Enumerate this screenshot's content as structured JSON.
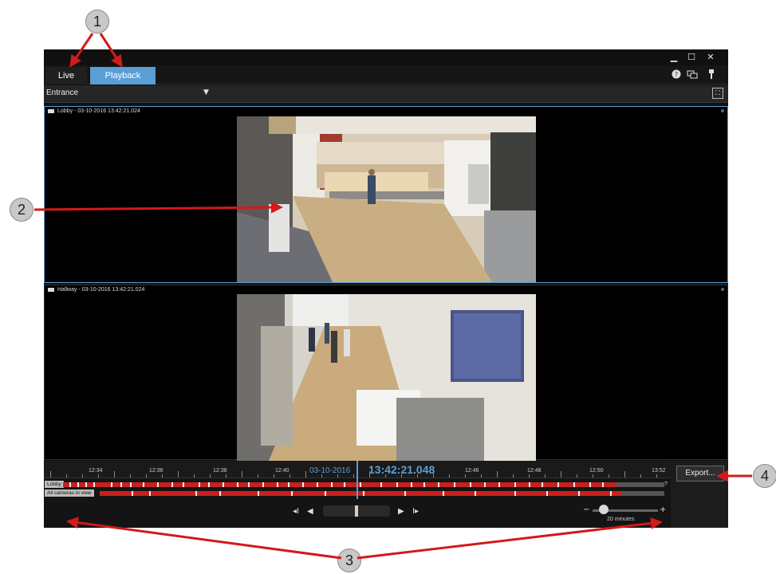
{
  "callouts": [
    "1",
    "2",
    "3",
    "4"
  ],
  "window": {
    "minimize": "▁",
    "maximize": "☐",
    "close": "✕"
  },
  "tabs": {
    "live": "Live",
    "playback": "Playback"
  },
  "toolbar_icons": [
    "help-icon",
    "settings-icon",
    "pin-icon"
  ],
  "view": {
    "selected": "Entrance",
    "chevron": "▼",
    "fullscreen": "⛶"
  },
  "cameras": [
    {
      "title": "Lobby - 03-10-2016 13:42:21.024"
    },
    {
      "title": "Hallway - 03-10-2016 13:42:21.024"
    }
  ],
  "timeline": {
    "ticks": [
      "12:34",
      "12:36",
      "12:38",
      "12:40",
      "12:46",
      "12:48",
      "12:50",
      "13:52"
    ],
    "date": "03-10-2016",
    "time": "13:42:21.048",
    "tracks": [
      {
        "label": "Lobby",
        "end_mark": "?"
      },
      {
        "label": "All cameras in view"
      }
    ],
    "zoom_label": "20 minutes"
  },
  "controls": {
    "prev_sequence": "◂I",
    "step_back": "◀",
    "play_forward": "▶",
    "next_sequence": "I▸",
    "zoom_minus": "−",
    "zoom_plus": "+"
  },
  "export": {
    "label": "Export..."
  },
  "colors": {
    "accent": "#5a9ed6",
    "recording": "#c92020",
    "arrow": "#d21a1a"
  }
}
